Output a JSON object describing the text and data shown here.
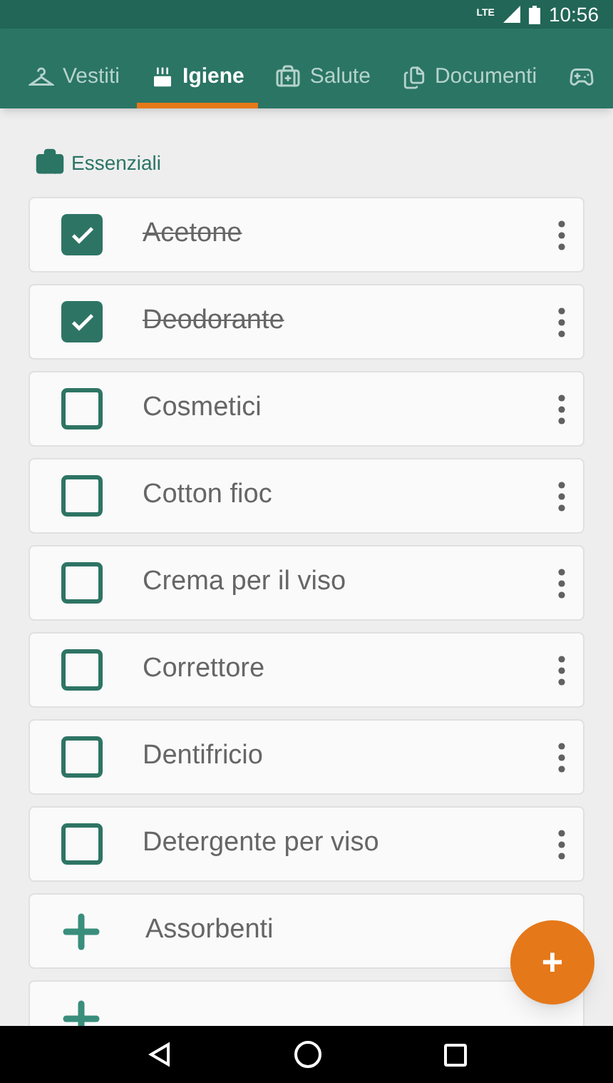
{
  "status_bar": {
    "network": "LTE",
    "time": "10:56"
  },
  "tabs": [
    {
      "label": "Vestiti",
      "selected": false
    },
    {
      "label": "Igiene",
      "selected": true
    },
    {
      "label": "Salute",
      "selected": false
    },
    {
      "label": "Documenti",
      "selected": false
    },
    {
      "selected": false
    }
  ],
  "section": {
    "title": "Essenziali"
  },
  "items": [
    {
      "kind": "check",
      "label": "Acetone",
      "checked": true
    },
    {
      "kind": "check",
      "label": "Deodorante",
      "checked": true
    },
    {
      "kind": "check",
      "label": "Cosmetici",
      "checked": false
    },
    {
      "kind": "check",
      "label": "Cotton fioc",
      "checked": false
    },
    {
      "kind": "check",
      "label": "Crema per il viso",
      "checked": false
    },
    {
      "kind": "check",
      "label": "Correttore",
      "checked": false
    },
    {
      "kind": "check",
      "label": "Dentifricio",
      "checked": false
    },
    {
      "kind": "check",
      "label": "Detergente per viso",
      "checked": false
    },
    {
      "kind": "add",
      "label": "Assorbenti"
    },
    {
      "kind": "add"
    }
  ],
  "fab": {
    "label": "+"
  }
}
